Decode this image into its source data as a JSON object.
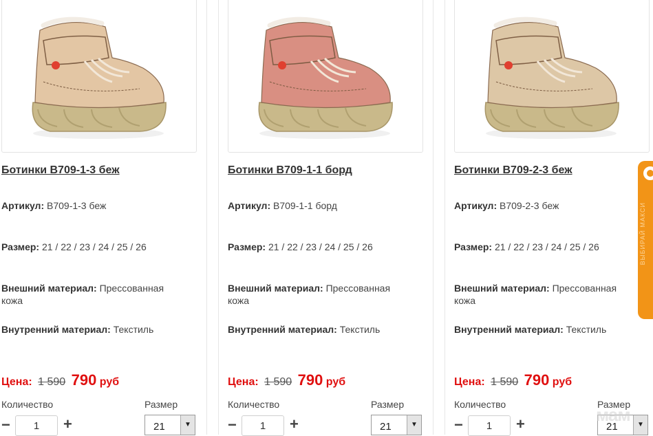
{
  "products": [
    {
      "title": "Ботинки B709-1-3 беж",
      "article_label": "Артикул:",
      "article": "B709-1-3 беж",
      "size_label": "Размер:",
      "sizes": "21 / 22 / 23 / 24 / 25 / 26",
      "outer_label": "Внешний материал:",
      "outer": "Прессованная кожа",
      "inner_label": "Внутренний материал:",
      "inner": "Текстиль",
      "price_label": "Цена:",
      "old_price": "1 590",
      "new_price": "790",
      "currency": "руб",
      "qty_label": "Количество",
      "qty": "1",
      "size_select_label": "Размер",
      "size_selected": "21",
      "shoe_color": "#e3c6a4"
    },
    {
      "title": "Ботинки B709-1-1 борд",
      "article_label": "Артикул:",
      "article": "B709-1-1 борд",
      "size_label": "Размер:",
      "sizes": "21 / 22 / 23 / 24 / 25 / 26",
      "outer_label": "Внешний материал:",
      "outer": "Прессованная кожа",
      "inner_label": "Внутренний материал:",
      "inner": "Текстиль",
      "price_label": "Цена:",
      "old_price": "1 590",
      "new_price": "790",
      "currency": "руб",
      "qty_label": "Количество",
      "qty": "1",
      "size_select_label": "Размер",
      "size_selected": "21",
      "shoe_color": "#d98f82"
    },
    {
      "title": "Ботинки B709-2-3 беж",
      "article_label": "Артикул:",
      "article": "B709-2-3 беж",
      "size_label": "Размер:",
      "sizes": "21 / 22 / 23 / 24 / 25 / 26",
      "outer_label": "Внешний материал:",
      "outer": "Прессованная кожа",
      "inner_label": "Внутренний материал:",
      "inner": "Текстиль",
      "price_label": "Цена:",
      "old_price": "1 590",
      "new_price": "790",
      "currency": "руб",
      "qty_label": "Количество",
      "qty": "1",
      "size_select_label": "Размер",
      "size_selected": "21",
      "shoe_color": "#ddc7a6"
    }
  ],
  "controls": {
    "minus": "−",
    "plus": "+",
    "dropdown_arrow": "▼"
  },
  "side_tab": {
    "icon": "circle-ring-icon",
    "text": "ВЫБИРАЙ МАКСИ",
    "color": "#f29417"
  },
  "watermark": {
    "text": "мам"
  },
  "colors": {
    "price": "#e01010",
    "border": "#e3e3e3"
  }
}
